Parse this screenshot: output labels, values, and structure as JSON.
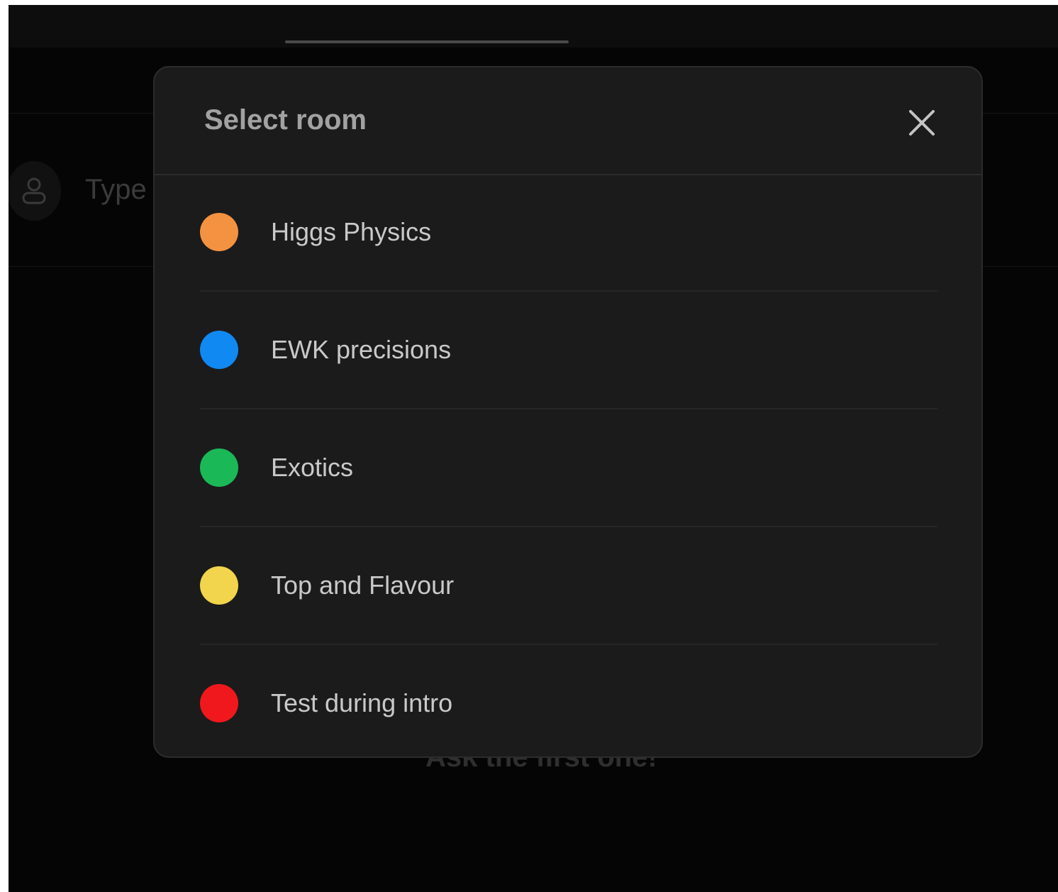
{
  "background": {
    "input_placeholder": "Type",
    "empty_message": "Ask the first one!"
  },
  "modal": {
    "title": "Select room",
    "close_icon": "close-icon",
    "rooms": [
      {
        "label": "Higgs Physics",
        "color": "#F39241"
      },
      {
        "label": "EWK precisions",
        "color": "#1089F3"
      },
      {
        "label": "Exotics",
        "color": "#1BB858"
      },
      {
        "label": "Top and Flavour",
        "color": "#F2D44D"
      },
      {
        "label": "Test during intro",
        "color": "#F0181D"
      }
    ]
  },
  "colors": {
    "modal_background": "#1B1B1B",
    "page_background": "#050505"
  }
}
